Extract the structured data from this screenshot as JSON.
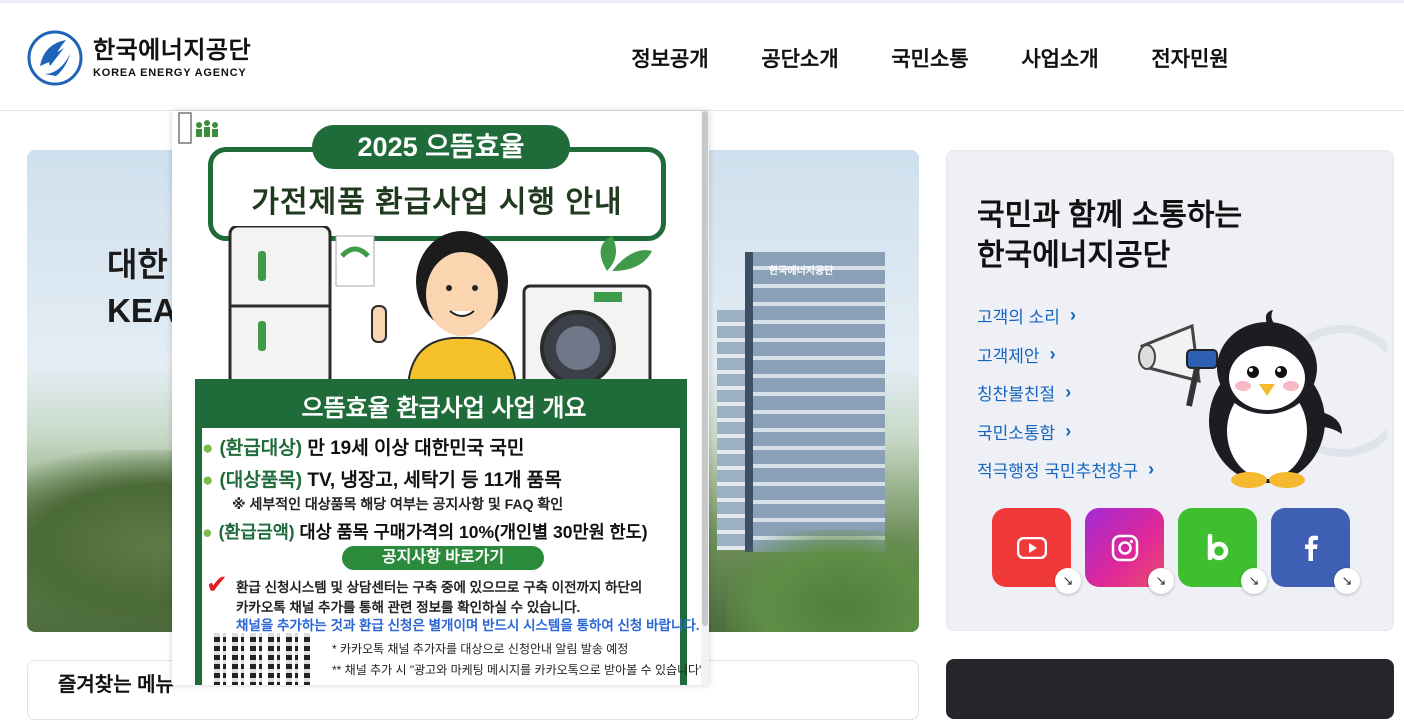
{
  "header": {
    "logo_ko": "한국에너지공단",
    "logo_en": "KOREA ENERGY AGENCY",
    "nav": [
      "정보공개",
      "공단소개",
      "국민소통",
      "사업소개",
      "전자민원"
    ]
  },
  "hero": {
    "title_line1": "대한",
    "title_line2": "KEA",
    "building_sign": "한국에너지공단"
  },
  "popup": {
    "year_pill": "2025 으뜸효율",
    "headline": "가전제품 환급사업 시행 안내",
    "box_title": "으뜸효율 환급사업 사업 개요",
    "bullets": [
      {
        "key": "(환급대상)",
        "text": " 만 19세 이상 대한민국 국민"
      },
      {
        "key": "(대상품목)",
        "text": " TV, 냉장고, 세탁기 등 11개 품목"
      },
      {
        "key": "(환급금액)",
        "text": " 대상 품목 구매가격의 10%(개인별 30만원 한도)"
      }
    ],
    "note": "※ 세부적인 대상품목 해당 여부는 공지사항 및 FAQ 확인",
    "link_label": "공지사항 바로가기",
    "check_mark": "✔",
    "info_line1": "환급 신청시스템 및 상담센터는 구축 중에 있으므로 구축 이전까지 하단의",
    "info_line2": "카카오톡 채널 추가를 통해 관련 정보를 확인하실 수 있습니다.",
    "info_blue": "채널을 추가하는 것과 환급 신청은 별개이며 반드시 시스템을 통하여 신청 바랍니다.",
    "foot_line1": "* 카카오톡 채널 추가자를 대상으로 신청안내 알림 발송 예정",
    "foot_line2": "** 채널 추가 시 \"광고와 마케팅 메시지를 카카오톡으로 받아볼 수 있습니다\""
  },
  "communication": {
    "title_line1": "국민과 함께 소통하는",
    "title_line2": "한국에너지공단",
    "links": [
      "고객의 소리",
      "고객제안",
      "칭찬불친절",
      "국민소통함",
      "적극행정 국민추천창구"
    ],
    "sns": [
      "youtube",
      "instagram",
      "blog",
      "facebook"
    ],
    "sns_arrow": "↘"
  },
  "favorites": {
    "title": "즐겨찾는 메뉴"
  },
  "colors": {
    "brand_blue": "#1565c0",
    "popup_green": "#1f6b3a",
    "youtube": "#f03a3a",
    "blog": "#3fbf2f",
    "facebook": "#3f5fb4"
  }
}
